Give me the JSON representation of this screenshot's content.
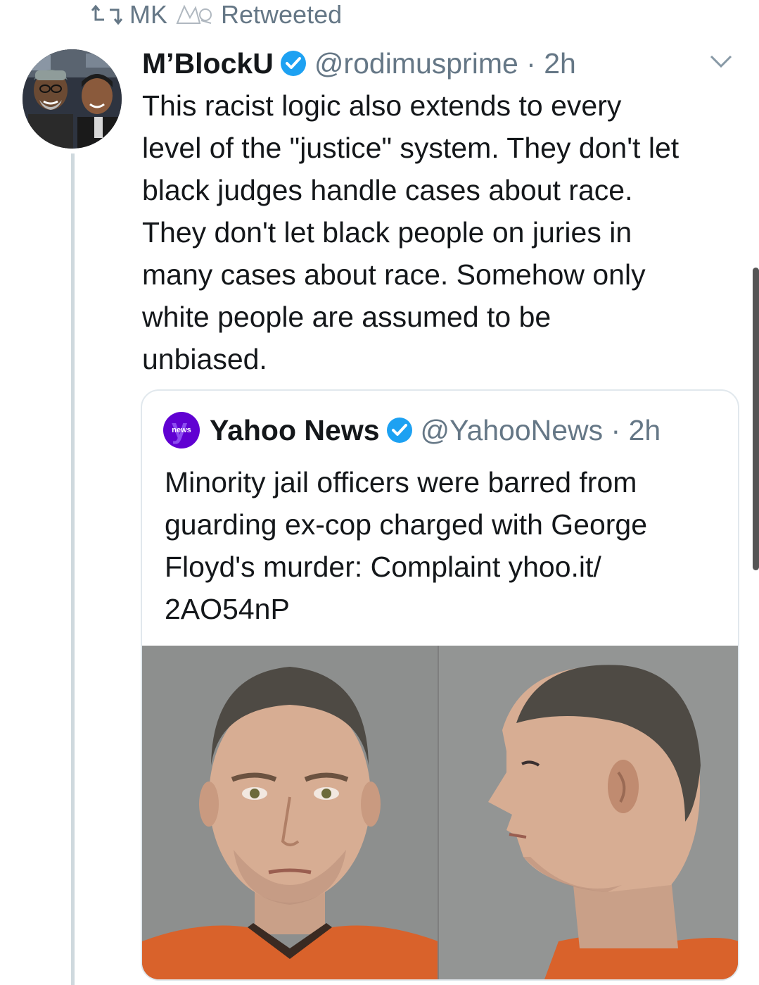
{
  "retweet": {
    "user": "MK",
    "label": "Retweeted"
  },
  "tweet": {
    "display_name": "M’BlockU",
    "handle_time": "@rodimusprime · 2h",
    "verified": true,
    "text_lines": [
      "This racist logic also extends to every",
      "level of the \"justice\" system. They don't let",
      "black judges handle cases about race.",
      "They don't let black people on juries in",
      "many cases about race. Somehow only",
      "white people are assumed to be",
      "unbiased."
    ]
  },
  "quoted": {
    "logo_text": "news",
    "display_name": "Yahoo News",
    "handle_time": "@YahooNews · 2h",
    "verified": true,
    "text_lines": [
      "Minority jail officers were barred from",
      "guarding ex-cop charged with George",
      "Floyd's murder: Complaint yhoo.it/",
      "2AO54nP"
    ]
  },
  "colors": {
    "accent": "#1da1f2",
    "secondary_text": "#657786",
    "yahoo_purple": "#6001d2",
    "jumpsuit_orange": "#d9622b"
  },
  "icons": {
    "retweet": "retweet-icon",
    "verified": "verified-badge-icon",
    "caret": "chevron-down-icon"
  }
}
